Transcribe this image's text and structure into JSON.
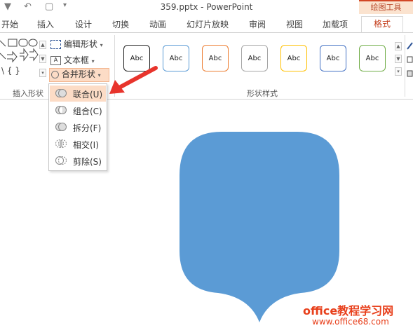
{
  "window": {
    "title": "359.pptx - PowerPoint",
    "tool_context": "绘图工具"
  },
  "tabs": [
    "开始",
    "插入",
    "设计",
    "切换",
    "动画",
    "幻灯片放映",
    "审阅",
    "视图",
    "加载项",
    "格式"
  ],
  "active_tab": "格式",
  "ribbon": {
    "insert_shapes": {
      "edit_shape": "编辑形状",
      "text_box": "文本框",
      "merge_shapes": "合并形状",
      "group_label": "插入形状"
    },
    "shape_styles": {
      "group_label": "形状样式",
      "style_sample": "Abc",
      "swatches": [
        "#222222",
        "#5b9bd5",
        "#ed7d31",
        "#a5a5a5",
        "#ffc000",
        "#4472c4",
        "#70ad47"
      ]
    }
  },
  "merge_menu": {
    "items": [
      {
        "label": "联合(U)",
        "highlighted": true
      },
      {
        "label": "组合(C)"
      },
      {
        "label": "拆分(F)"
      },
      {
        "label": "相交(I)"
      },
      {
        "label": "剪除(S)"
      }
    ]
  },
  "slide": {
    "shape_color": "#5b9bd5"
  },
  "watermark": {
    "line1": "office教程学习网",
    "line2": "www.office68.com"
  },
  "colors": {
    "accent": "#d24726",
    "arrow": "#e8342c"
  }
}
